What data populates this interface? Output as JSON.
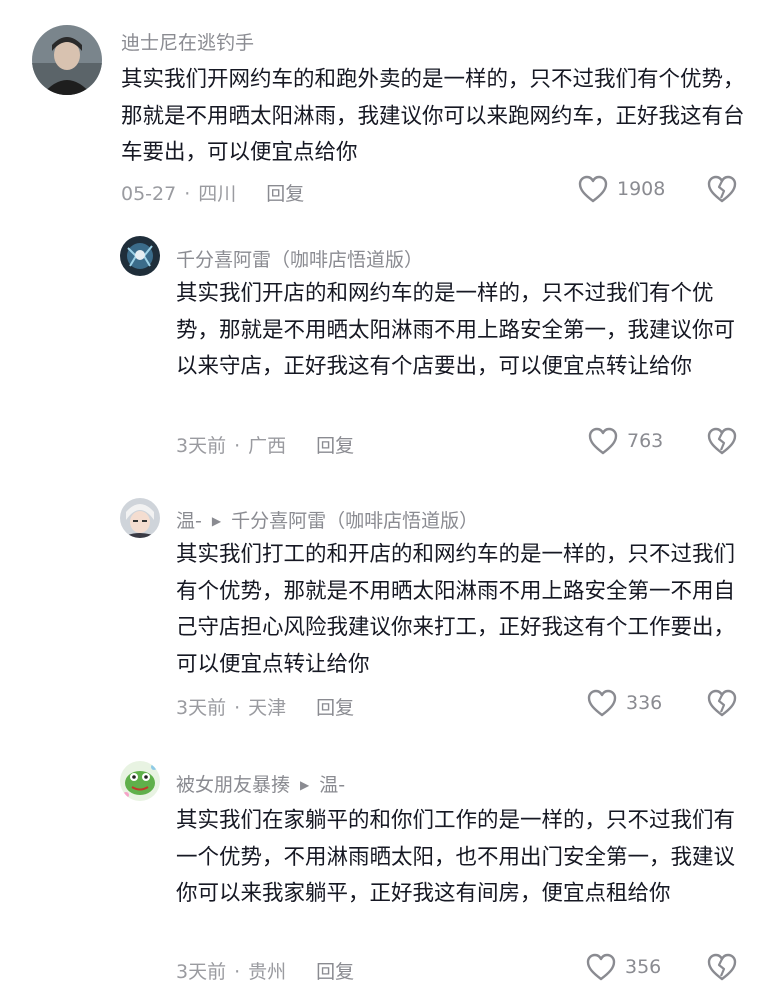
{
  "comments": [
    {
      "username": "迪士尼在逃钓手",
      "reply_to": "",
      "text": "其实我们开网约车的和跑外卖的是一样的，只不过我们有个优势，那就是不用晒太阳淋雨，我建议你可以来跑网约车，正好我这有台车要出，可以便宜点给你",
      "date": "05-27",
      "location": "四川",
      "reply_label": "回复",
      "likes": "1908"
    },
    {
      "username": "千分喜阿雷（咖啡店悟道版）",
      "reply_to": "",
      "text": "其实我们开店的和网约车的是一样的，只不过我们有个优势，那就是不用晒太阳淋雨不用上路安全第一，我建议你可以来守店，正好我这有个店要出，可以便宜点转让给你",
      "date": "3天前",
      "location": "广西",
      "reply_label": "回复",
      "likes": "763"
    },
    {
      "username": "温-",
      "reply_to": "千分喜阿雷（咖啡店悟道版）",
      "text": "其实我们打工的和开店的和网约车的是一样的，只不过我们有个优势，那就是不用晒太阳淋雨不用上路安全第一不用自己守店担心风险我建议你来打工，正好我这有个工作要出，可以便宜点转让给你",
      "date": "3天前",
      "location": "天津",
      "reply_label": "回复",
      "likes": "336"
    },
    {
      "username": "被女朋友暴揍",
      "reply_to": "温-",
      "text": "其实我们在家躺平的和你们工作的是一样的，只不过我们有一个优势，不用淋雨晒太阳，也不用出门安全第一，我建议你可以来我家躺平，正好我这有间房，便宜点租给你",
      "date": "3天前",
      "location": "贵州",
      "reply_label": "回复",
      "likes": "356"
    }
  ],
  "icons": {
    "like": "heart-outline-icon",
    "dislike": "broken-heart-icon",
    "reply_arrow": "triangle-right-icon"
  },
  "colors": {
    "text": "#161823",
    "secondary": "#8a8b91",
    "background": "#ffffff"
  }
}
